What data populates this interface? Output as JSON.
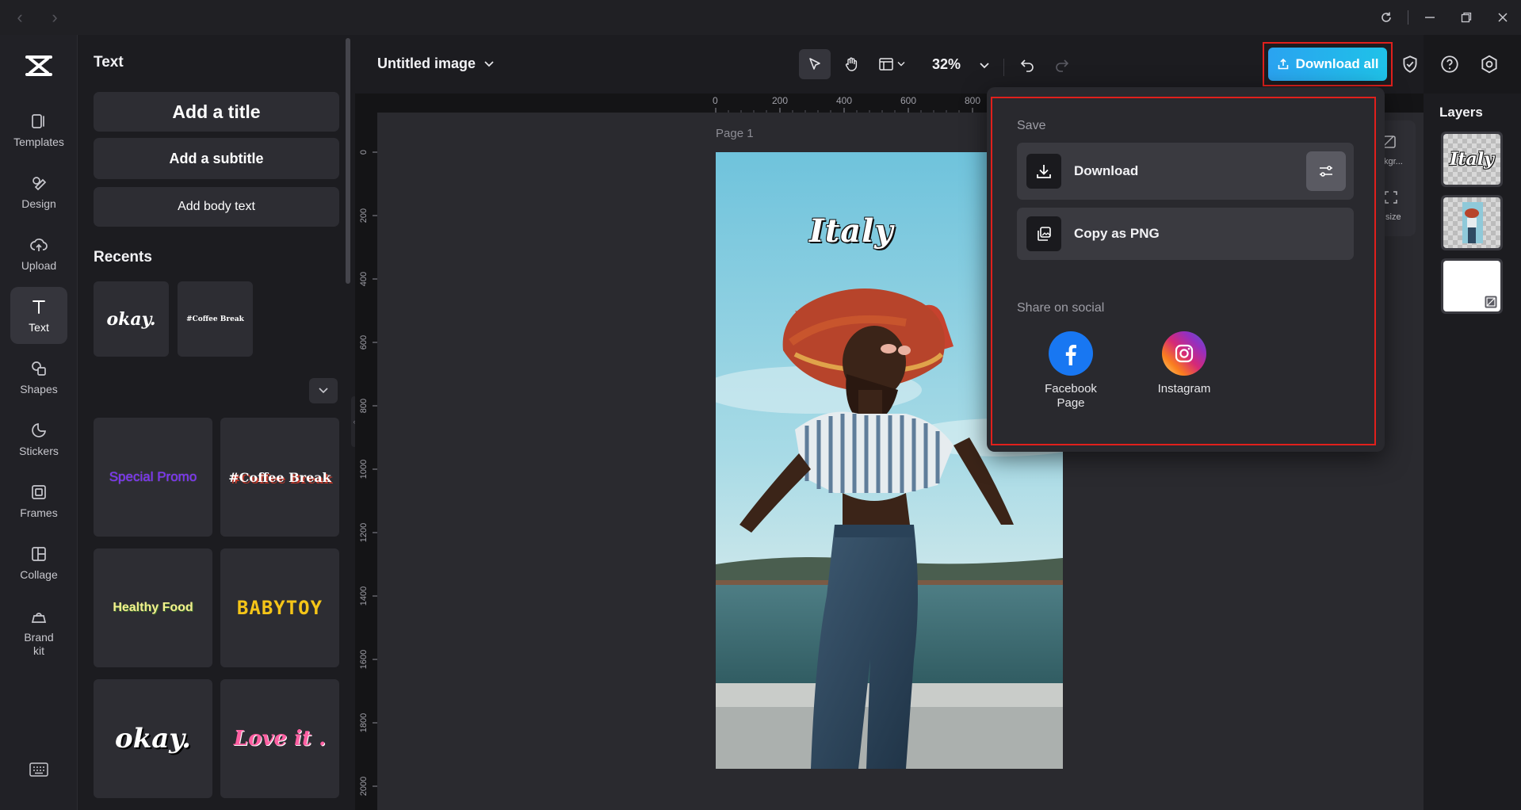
{
  "app": {
    "window_controls": [
      "minimize",
      "maximize",
      "close"
    ]
  },
  "rail": {
    "items": [
      {
        "label": "Templates",
        "icon": "templates-icon"
      },
      {
        "label": "Design",
        "icon": "design-icon"
      },
      {
        "label": "Upload",
        "icon": "upload-icon"
      },
      {
        "label": "Text",
        "icon": "text-icon",
        "active": true
      },
      {
        "label": "Shapes",
        "icon": "shapes-icon"
      },
      {
        "label": "Stickers",
        "icon": "stickers-icon"
      },
      {
        "label": "Frames",
        "icon": "frames-icon"
      },
      {
        "label": "Collage",
        "icon": "collage-icon"
      },
      {
        "label": "Brand kit",
        "icon": "brand-kit-icon"
      }
    ]
  },
  "panel": {
    "title": "Text",
    "add_title": "Add a title",
    "add_subtitle": "Add a subtitle",
    "add_body": "Add body text",
    "recents_title": "Recents",
    "recents": [
      "okay.",
      "#Coffee Break"
    ],
    "styles": [
      {
        "text": "Special Promo",
        "color": "#7b2ff7"
      },
      {
        "text": "#Coffee Break",
        "color": "#ffffff"
      },
      {
        "text": "Healthy Food",
        "color": "#f4ef8f"
      },
      {
        "text": "BABYTOY",
        "color": "#f5c518"
      },
      {
        "text": "okay.",
        "color": "#ffffff"
      },
      {
        "text": "Love it .",
        "color": "#ff5fa2"
      }
    ]
  },
  "topbar": {
    "doc_title": "Untitled image",
    "zoom": "32%",
    "download_all": "Download all"
  },
  "ruler": {
    "h_ticks": [
      "0",
      "200",
      "400",
      "600",
      "800"
    ],
    "v_ticks": [
      "0",
      "200",
      "400",
      "600",
      "800",
      "1000",
      "1200",
      "1400",
      "1600",
      "1800",
      "2000"
    ]
  },
  "canvas": {
    "page_label": "Page 1",
    "text_on_image": "Italy"
  },
  "side_card": {
    "bg_label": "kgr...",
    "size_label": "size"
  },
  "layers": {
    "title": "Layers",
    "thumb_text": "Italy"
  },
  "popover": {
    "save_label": "Save",
    "download": "Download",
    "copy_png": "Copy as PNG",
    "share_label": "Share on social",
    "facebook": "Facebook Page",
    "instagram": "Instagram"
  },
  "colors": {
    "accent": "#1fb6ef",
    "highlight": "#e0201c",
    "facebook": "#1877f2"
  }
}
